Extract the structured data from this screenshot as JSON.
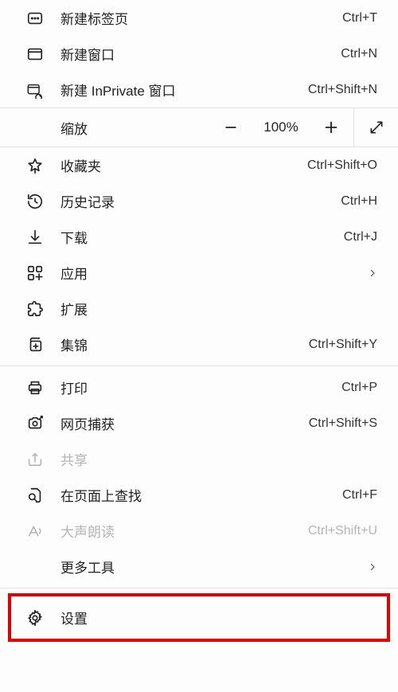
{
  "section1": {
    "new_tab": {
      "label": "新建标签页",
      "shortcut": "Ctrl+T"
    },
    "new_window": {
      "label": "新建窗口",
      "shortcut": "Ctrl+N"
    },
    "new_inprivate": {
      "label": "新建 InPrivate 窗口",
      "shortcut": "Ctrl+Shift+N"
    }
  },
  "zoom": {
    "label": "缩放",
    "value": "100%"
  },
  "section2": {
    "favorites": {
      "label": "收藏夹",
      "shortcut": "Ctrl+Shift+O"
    },
    "history": {
      "label": "历史记录",
      "shortcut": "Ctrl+H"
    },
    "downloads": {
      "label": "下载",
      "shortcut": "Ctrl+J"
    },
    "apps": {
      "label": "应用"
    },
    "extensions": {
      "label": "扩展"
    },
    "collections": {
      "label": "集锦",
      "shortcut": "Ctrl+Shift+Y"
    }
  },
  "section3": {
    "print": {
      "label": "打印",
      "shortcut": "Ctrl+P"
    },
    "capture": {
      "label": "网页捕获",
      "shortcut": "Ctrl+Shift+S"
    },
    "share": {
      "label": "共享"
    },
    "find": {
      "label": "在页面上查找",
      "shortcut": "Ctrl+F"
    },
    "read_aloud": {
      "label": "大声朗读",
      "shortcut": "Ctrl+Shift+U"
    },
    "more_tools": {
      "label": "更多工具"
    }
  },
  "section4": {
    "settings": {
      "label": "设置"
    }
  }
}
